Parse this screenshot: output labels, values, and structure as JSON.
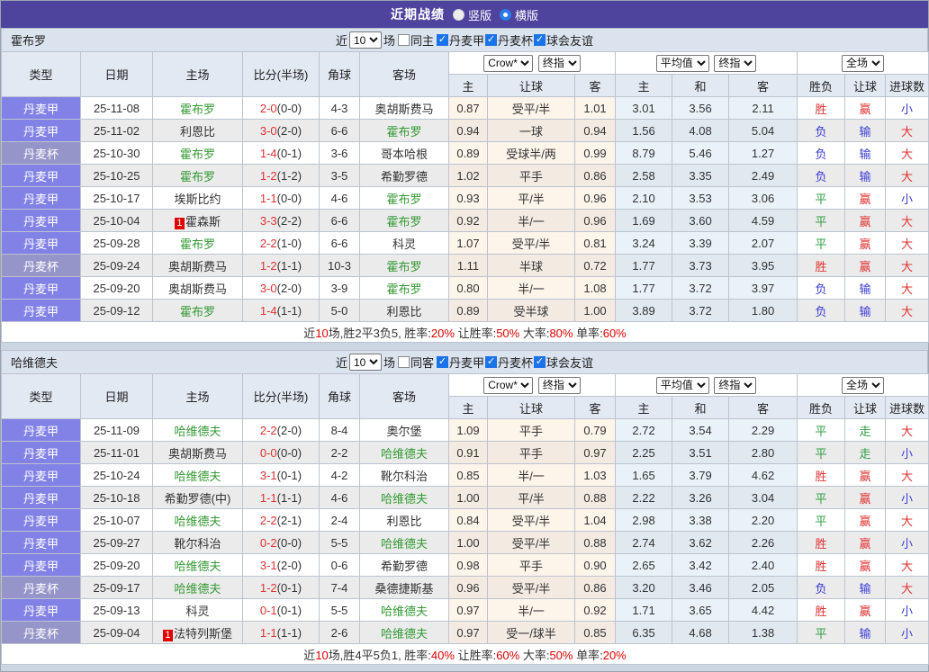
{
  "title_bar": {
    "title": "近期战绩",
    "layout_options": [
      {
        "label": "竖版",
        "selected": false
      },
      {
        "label": "横版",
        "selected": true
      }
    ]
  },
  "table_header": {
    "static_cols": [
      "类型",
      "日期",
      "主场",
      "比分(半场)",
      "角球",
      "客场"
    ],
    "odds_group1": {
      "select1": "Crow*",
      "select2": "终指",
      "sub": [
        "主",
        "让球",
        "客"
      ]
    },
    "odds_group2": {
      "select1": "平均值",
      "select2": "终指",
      "sub": [
        "主",
        "和",
        "客"
      ]
    },
    "result_group": {
      "select": "全场",
      "sub": [
        "胜负",
        "让球",
        "进球数"
      ]
    }
  },
  "colors": {
    "accent_purple": "#4e449e",
    "league_cell": "#8181e6",
    "cup_cell": "#9695c9",
    "win_red": "#e03333",
    "draw_green": "#2f9e44",
    "lose_blue": "#3b3bd6",
    "team_green": "#339933",
    "checkbox_blue": "#1a73e8"
  },
  "teams": [
    {
      "name": "霍布罗",
      "filter": {
        "prefix": "近",
        "count_value": "10",
        "suffix": "场",
        "same_label": "同主",
        "same_checked": false,
        "league_filters": [
          {
            "label": "丹麦甲",
            "checked": true
          },
          {
            "label": "丹麦杯",
            "checked": true
          },
          {
            "label": "球会友谊",
            "checked": true
          }
        ]
      },
      "rows": [
        {
          "league": "丹麦甲",
          "date": "25-11-08",
          "home": "霍布罗",
          "home_highlight": true,
          "home_badge": "",
          "score": "2-0",
          "half": "(0-0)",
          "corner": "4-3",
          "away": "奥胡斯费马",
          "away_highlight": false,
          "odds": [
            "0.87",
            "受平/半",
            "1.01",
            "3.01",
            "3.56",
            "2.11"
          ],
          "result": "胜",
          "result_color": "red",
          "handicap": "赢",
          "handicap_color": "red",
          "goals": "小",
          "goals_color": "blue"
        },
        {
          "league": "丹麦甲",
          "date": "25-11-02",
          "home": "利恩比",
          "home_highlight": false,
          "home_badge": "",
          "score": "3-0",
          "half": "(2-0)",
          "corner": "6-6",
          "away": "霍布罗",
          "away_highlight": true,
          "odds": [
            "0.94",
            "一球",
            "0.94",
            "1.56",
            "4.08",
            "5.04"
          ],
          "result": "负",
          "result_color": "blue",
          "handicap": "输",
          "handicap_color": "blue",
          "goals": "大",
          "goals_color": "red"
        },
        {
          "league": "丹麦杯",
          "date": "25-10-30",
          "home": "霍布罗",
          "home_highlight": true,
          "home_badge": "",
          "score": "1-4",
          "half": "(0-1)",
          "corner": "3-6",
          "away": "哥本哈根",
          "away_highlight": false,
          "odds": [
            "0.89",
            "受球半/两",
            "0.99",
            "8.79",
            "5.46",
            "1.27"
          ],
          "result": "负",
          "result_color": "blue",
          "handicap": "输",
          "handicap_color": "blue",
          "goals": "大",
          "goals_color": "red"
        },
        {
          "league": "丹麦甲",
          "date": "25-10-25",
          "home": "霍布罗",
          "home_highlight": true,
          "home_badge": "",
          "score": "1-2",
          "half": "(1-2)",
          "corner": "3-5",
          "away": "希勤罗德",
          "away_highlight": false,
          "odds": [
            "1.02",
            "平手",
            "0.86",
            "2.58",
            "3.35",
            "2.49"
          ],
          "result": "负",
          "result_color": "blue",
          "handicap": "输",
          "handicap_color": "blue",
          "goals": "大",
          "goals_color": "red"
        },
        {
          "league": "丹麦甲",
          "date": "25-10-17",
          "home": "埃斯比约",
          "home_highlight": false,
          "home_badge": "",
          "score": "1-1",
          "half": "(0-0)",
          "corner": "4-6",
          "away": "霍布罗",
          "away_highlight": true,
          "odds": [
            "0.93",
            "平/半",
            "0.96",
            "2.10",
            "3.53",
            "3.06"
          ],
          "result": "平",
          "result_color": "green",
          "handicap": "赢",
          "handicap_color": "red",
          "goals": "小",
          "goals_color": "blue"
        },
        {
          "league": "丹麦甲",
          "date": "25-10-04",
          "home": "霍森斯",
          "home_highlight": false,
          "home_badge": "1",
          "score": "3-3",
          "half": "(2-2)",
          "corner": "6-6",
          "away": "霍布罗",
          "away_highlight": true,
          "odds": [
            "0.92",
            "半/一",
            "0.96",
            "1.69",
            "3.60",
            "4.59"
          ],
          "result": "平",
          "result_color": "green",
          "handicap": "赢",
          "handicap_color": "red",
          "goals": "大",
          "goals_color": "red"
        },
        {
          "league": "丹麦甲",
          "date": "25-09-28",
          "home": "霍布罗",
          "home_highlight": true,
          "home_badge": "",
          "score": "2-2",
          "half": "(1-0)",
          "corner": "6-6",
          "away": "科灵",
          "away_highlight": false,
          "odds": [
            "1.07",
            "受平/半",
            "0.81",
            "3.24",
            "3.39",
            "2.07"
          ],
          "result": "平",
          "result_color": "green",
          "handicap": "赢",
          "handicap_color": "red",
          "goals": "大",
          "goals_color": "red"
        },
        {
          "league": "丹麦杯",
          "date": "25-09-24",
          "home": "奥胡斯费马",
          "home_highlight": false,
          "home_badge": "",
          "score": "1-2",
          "half": "(1-1)",
          "corner": "10-3",
          "away": "霍布罗",
          "away_highlight": true,
          "odds": [
            "1.11",
            "半球",
            "0.72",
            "1.77",
            "3.73",
            "3.95"
          ],
          "result": "胜",
          "result_color": "red",
          "handicap": "赢",
          "handicap_color": "red",
          "goals": "大",
          "goals_color": "red"
        },
        {
          "league": "丹麦甲",
          "date": "25-09-20",
          "home": "奥胡斯费马",
          "home_highlight": false,
          "home_badge": "",
          "score": "3-0",
          "half": "(2-0)",
          "corner": "3-9",
          "away": "霍布罗",
          "away_highlight": true,
          "odds": [
            "0.80",
            "半/一",
            "1.08",
            "1.77",
            "3.72",
            "3.97"
          ],
          "result": "负",
          "result_color": "blue",
          "handicap": "输",
          "handicap_color": "blue",
          "goals": "大",
          "goals_color": "red"
        },
        {
          "league": "丹麦甲",
          "date": "25-09-12",
          "home": "霍布罗",
          "home_highlight": true,
          "home_badge": "",
          "score": "1-4",
          "half": "(1-1)",
          "corner": "5-0",
          "away": "利恩比",
          "away_highlight": false,
          "odds": [
            "0.89",
            "受半球",
            "1.00",
            "3.89",
            "3.72",
            "1.80"
          ],
          "result": "负",
          "result_color": "blue",
          "handicap": "输",
          "handicap_color": "blue",
          "goals": "大",
          "goals_color": "red"
        }
      ],
      "summary": [
        {
          "text": "近",
          "red": false
        },
        {
          "text": "10",
          "red": true
        },
        {
          "text": "场,胜2平3负5, 胜率:",
          "red": false
        },
        {
          "text": "20%",
          "red": true
        },
        {
          "text": " 让胜率:",
          "red": false
        },
        {
          "text": "50%",
          "red": true
        },
        {
          "text": " 大率:",
          "red": false
        },
        {
          "text": "80%",
          "red": true
        },
        {
          "text": " 单率:",
          "red": false
        },
        {
          "text": "60%",
          "red": true
        }
      ]
    },
    {
      "name": "哈维德夫",
      "filter": {
        "prefix": "近",
        "count_value": "10",
        "suffix": "场",
        "same_label": "同客",
        "same_checked": false,
        "league_filters": [
          {
            "label": "丹麦甲",
            "checked": true
          },
          {
            "label": "丹麦杯",
            "checked": true
          },
          {
            "label": "球会友谊",
            "checked": true
          }
        ]
      },
      "rows": [
        {
          "league": "丹麦甲",
          "date": "25-11-09",
          "home": "哈维德夫",
          "home_highlight": true,
          "home_badge": "",
          "score": "2-2",
          "half": "(2-0)",
          "corner": "8-4",
          "away": "奥尔堡",
          "away_highlight": false,
          "odds": [
            "1.09",
            "平手",
            "0.79",
            "2.72",
            "3.54",
            "2.29"
          ],
          "result": "平",
          "result_color": "green",
          "handicap": "走",
          "handicap_color": "green",
          "goals": "大",
          "goals_color": "red"
        },
        {
          "league": "丹麦甲",
          "date": "25-11-01",
          "home": "奥胡斯费马",
          "home_highlight": false,
          "home_badge": "",
          "score": "0-0",
          "half": "(0-0)",
          "corner": "2-2",
          "away": "哈维德夫",
          "away_highlight": true,
          "odds": [
            "0.91",
            "平手",
            "0.97",
            "2.25",
            "3.51",
            "2.80"
          ],
          "result": "平",
          "result_color": "green",
          "handicap": "走",
          "handicap_color": "green",
          "goals": "小",
          "goals_color": "blue"
        },
        {
          "league": "丹麦甲",
          "date": "25-10-24",
          "home": "哈维德夫",
          "home_highlight": true,
          "home_badge": "",
          "score": "3-1",
          "half": "(0-1)",
          "corner": "4-2",
          "away": "靴尔科治",
          "away_highlight": false,
          "odds": [
            "0.85",
            "半/一",
            "1.03",
            "1.65",
            "3.79",
            "4.62"
          ],
          "result": "胜",
          "result_color": "red",
          "handicap": "赢",
          "handicap_color": "red",
          "goals": "大",
          "goals_color": "red"
        },
        {
          "league": "丹麦甲",
          "date": "25-10-18",
          "home": "希勤罗德(中)",
          "home_highlight": false,
          "home_badge": "",
          "score": "1-1",
          "half": "(1-1)",
          "corner": "4-6",
          "away": "哈维德夫",
          "away_highlight": true,
          "odds": [
            "1.00",
            "平/半",
            "0.88",
            "2.22",
            "3.26",
            "3.04"
          ],
          "result": "平",
          "result_color": "green",
          "handicap": "赢",
          "handicap_color": "red",
          "goals": "小",
          "goals_color": "blue"
        },
        {
          "league": "丹麦甲",
          "date": "25-10-07",
          "home": "哈维德夫",
          "home_highlight": true,
          "home_badge": "",
          "score": "2-2",
          "half": "(2-1)",
          "corner": "2-4",
          "away": "利恩比",
          "away_highlight": false,
          "odds": [
            "0.84",
            "受平/半",
            "1.04",
            "2.98",
            "3.38",
            "2.20"
          ],
          "result": "平",
          "result_color": "green",
          "handicap": "赢",
          "handicap_color": "red",
          "goals": "大",
          "goals_color": "red"
        },
        {
          "league": "丹麦甲",
          "date": "25-09-27",
          "home": "靴尔科治",
          "home_highlight": false,
          "home_badge": "",
          "score": "0-2",
          "half": "(0-0)",
          "corner": "5-5",
          "away": "哈维德夫",
          "away_highlight": true,
          "odds": [
            "1.00",
            "受平/半",
            "0.88",
            "2.74",
            "3.62",
            "2.26"
          ],
          "result": "胜",
          "result_color": "red",
          "handicap": "赢",
          "handicap_color": "red",
          "goals": "小",
          "goals_color": "blue"
        },
        {
          "league": "丹麦甲",
          "date": "25-09-20",
          "home": "哈维德夫",
          "home_highlight": true,
          "home_badge": "",
          "score": "3-1",
          "half": "(2-0)",
          "corner": "0-6",
          "away": "希勤罗德",
          "away_highlight": false,
          "odds": [
            "0.98",
            "平手",
            "0.90",
            "2.65",
            "3.42",
            "2.40"
          ],
          "result": "胜",
          "result_color": "red",
          "handicap": "赢",
          "handicap_color": "red",
          "goals": "大",
          "goals_color": "red"
        },
        {
          "league": "丹麦杯",
          "date": "25-09-17",
          "home": "哈维德夫",
          "home_highlight": true,
          "home_badge": "",
          "score": "1-2",
          "half": "(0-1)",
          "corner": "7-4",
          "away": "桑德捷斯基",
          "away_highlight": false,
          "odds": [
            "0.96",
            "受平/半",
            "0.86",
            "3.20",
            "3.46",
            "2.05"
          ],
          "result": "负",
          "result_color": "blue",
          "handicap": "输",
          "handicap_color": "blue",
          "goals": "大",
          "goals_color": "red"
        },
        {
          "league": "丹麦甲",
          "date": "25-09-13",
          "home": "科灵",
          "home_highlight": false,
          "home_badge": "",
          "score": "0-1",
          "half": "(0-1)",
          "corner": "5-5",
          "away": "哈维德夫",
          "away_highlight": true,
          "odds": [
            "0.97",
            "半/一",
            "0.92",
            "1.71",
            "3.65",
            "4.42"
          ],
          "result": "胜",
          "result_color": "red",
          "handicap": "赢",
          "handicap_color": "red",
          "goals": "小",
          "goals_color": "blue"
        },
        {
          "league": "丹麦杯",
          "date": "25-09-04",
          "home": "法特列斯堡",
          "home_highlight": false,
          "home_badge": "1",
          "score": "1-1",
          "half": "(1-1)",
          "corner": "2-6",
          "away": "哈维德夫",
          "away_highlight": true,
          "odds": [
            "0.97",
            "受一/球半",
            "0.85",
            "6.35",
            "4.68",
            "1.38"
          ],
          "result": "平",
          "result_color": "green",
          "handicap": "输",
          "handicap_color": "blue",
          "goals": "小",
          "goals_color": "blue"
        }
      ],
      "summary": [
        {
          "text": "近",
          "red": false
        },
        {
          "text": "10",
          "red": true
        },
        {
          "text": "场,胜4平5负1, 胜率:",
          "red": false
        },
        {
          "text": "40%",
          "red": true
        },
        {
          "text": " 让胜率:",
          "red": false
        },
        {
          "text": "60%",
          "red": true
        },
        {
          "text": " 大率:",
          "red": false
        },
        {
          "text": "50%",
          "red": true
        },
        {
          "text": " 单率:",
          "red": false
        },
        {
          "text": "20%",
          "red": true
        }
      ]
    }
  ]
}
